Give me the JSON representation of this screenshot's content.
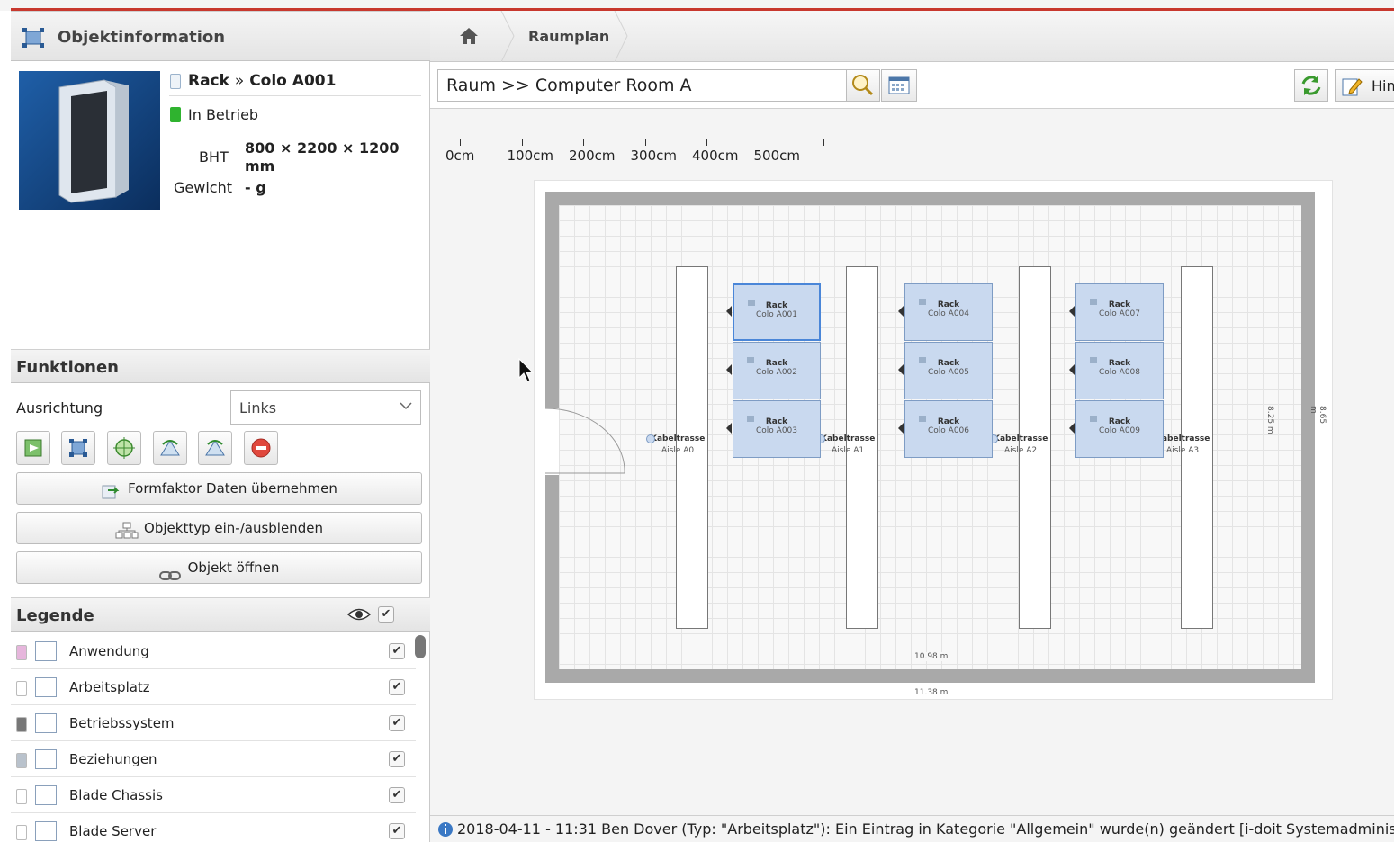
{
  "left": {
    "object_info": {
      "title": "Objektinformation"
    },
    "object": {
      "type": "Rack",
      "sep": "»",
      "name": "Colo A001",
      "status": "In Betrieb",
      "bht_label": "BHT",
      "bht_value": "800 × 2200 × 1200 mm",
      "weight_label": "Gewicht",
      "weight_value": "- g"
    },
    "functions": {
      "title": "Funktionen",
      "alignment_label": "Ausrichtung",
      "alignment_value": "Links",
      "buttons": [
        "Formfaktor Daten übernehmen",
        "Objekttyp ein-/ausblenden",
        "Objekt öffnen"
      ]
    },
    "legend": {
      "title": "Legende",
      "items": [
        {
          "label": "Anwendung",
          "color": "#e6b6dc"
        },
        {
          "label": "Arbeitsplatz",
          "color": "#ffffff"
        },
        {
          "label": "Betriebssystem",
          "color": "#777777"
        },
        {
          "label": "Beziehungen",
          "color": "#b9c2cc"
        },
        {
          "label": "Blade Chassis",
          "color": "#ffffff"
        },
        {
          "label": "Blade Server",
          "color": "#ffffff"
        }
      ]
    }
  },
  "right": {
    "breadcrumb": "Raumplan",
    "room_input": "Raum >> Computer Room A",
    "hint_button": "Hin",
    "scale_labels": [
      "0cm",
      "100cm",
      "200cm",
      "300cm",
      "400cm",
      "500cm"
    ],
    "racks": [
      {
        "type": "Rack",
        "name": "Colo A001"
      },
      {
        "type": "Rack",
        "name": "Colo A002"
      },
      {
        "type": "Rack",
        "name": "Colo A003"
      },
      {
        "type": "Rack",
        "name": "Colo A004"
      },
      {
        "type": "Rack",
        "name": "Colo A005"
      },
      {
        "type": "Rack",
        "name": "Colo A006"
      },
      {
        "type": "Rack",
        "name": "Colo A007"
      },
      {
        "type": "Rack",
        "name": "Colo A008"
      },
      {
        "type": "Rack",
        "name": "Colo A009"
      }
    ],
    "trays": [
      {
        "type": "Kabeltrasse",
        "name": "Aisle A0"
      },
      {
        "type": "Kabeltrasse",
        "name": "Aisle A1"
      },
      {
        "type": "Kabeltrasse",
        "name": "Aisle A2"
      },
      {
        "type": "Kabeltrasse",
        "name": "Aisle A3"
      }
    ],
    "dimensions": {
      "inner_width": "10.98 m",
      "outer_width": "11.38 m",
      "inner_height": "8.25 m",
      "outer_height": "8.65 m"
    },
    "status_message": "2018-04-11 - 11:31 Ben Dover (Typ: \"Arbeitsplatz\"): Ein Eintrag in Kategorie \"Allgemein\" wurde(n) geändert [i-doit Systemadministrator]"
  },
  "colors": {
    "accent_red": "#c8382e",
    "rack_fill": "#c9d9ef",
    "rack_border": "#7e9cc4",
    "status_green": "#2fb32f"
  }
}
